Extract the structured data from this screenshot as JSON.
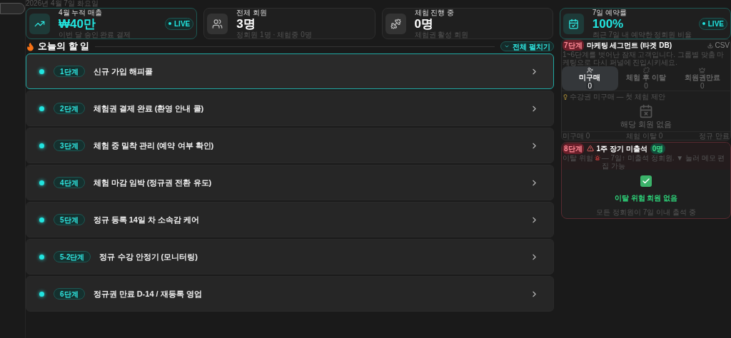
{
  "date": "2026년 4월 7일 화요일",
  "stats": [
    {
      "label": "4월 누적 매출",
      "value": "₩40만",
      "sub": "이번 달 승인 완료 결제",
      "highlighted": true,
      "live": true,
      "live_label": "LIVE"
    },
    {
      "label": "전체 회원",
      "value": "3명",
      "sub": "정회원 1명 · 체험중 0명",
      "highlighted": false,
      "live": false
    },
    {
      "label": "체험 진행 중",
      "value": "0명",
      "sub": "체험권 활성 회원",
      "highlighted": false,
      "live": false
    },
    {
      "label": "7일 예약률",
      "value": "100%",
      "sub": "최근 7일 내 예약한 정회원 비율",
      "highlighted": true,
      "live": true,
      "live_label": "LIVE"
    }
  ],
  "todo": {
    "title": "오늘의 할 일",
    "expand_label": "전체 펼치기",
    "items": [
      {
        "step": "1단계",
        "title": "신규 가입 해피콜",
        "selected": true
      },
      {
        "step": "2단계",
        "title": "체험권 결제 완료 (환영 안내 콜)",
        "selected": false
      },
      {
        "step": "3단계",
        "title": "체험 중 밀착 관리 (예약 여부 확인)",
        "selected": false
      },
      {
        "step": "4단계",
        "title": "체험 마감 임박 (정규권 전환 유도)",
        "selected": false
      },
      {
        "step": "5단계",
        "title": "정규 등록 14일 차 소속감 케어",
        "selected": false
      },
      {
        "step": "5-2단계",
        "title": "정규 수강 안정기 (모니터링)",
        "selected": false
      },
      {
        "step": "6단계",
        "title": "정규권 만료 D-14 / 재등록 영업",
        "selected": false
      }
    ]
  },
  "segment": {
    "step": "7단계",
    "title": "마케팅 세그먼트 (타겟 DB)",
    "csv_label": "CSV",
    "description": "1~6단계를 벗어난 잠재 고객입니다. 그룹별 맞춤 마케팅으로 다시 퍼널에 진입시키세요.",
    "tabs": [
      {
        "label": "미구매",
        "count": "0",
        "selected": true
      },
      {
        "label": "체험 후 이탈",
        "count": "0",
        "selected": false
      },
      {
        "label": "회원권만료",
        "count": "0",
        "selected": false
      }
    ],
    "tip": "수강권 미구매 — 첫 체험 제안",
    "empty_text": "해당 회원 없음",
    "footer": [
      "미구매 0",
      "체험 이탈 0",
      "정규 만료"
    ]
  },
  "risk": {
    "step": "8단계",
    "title": "1주 장기 미출석",
    "count": "0명",
    "description_before": "이탈 위험",
    "description_after": "— 7일↑ 미출석 정회원. ▼ 눌러 메모 편집 가능",
    "empty_title": "이탈 위험 회원 없음",
    "empty_sub": "모든 정회원이 7일 이내 출석 중"
  }
}
